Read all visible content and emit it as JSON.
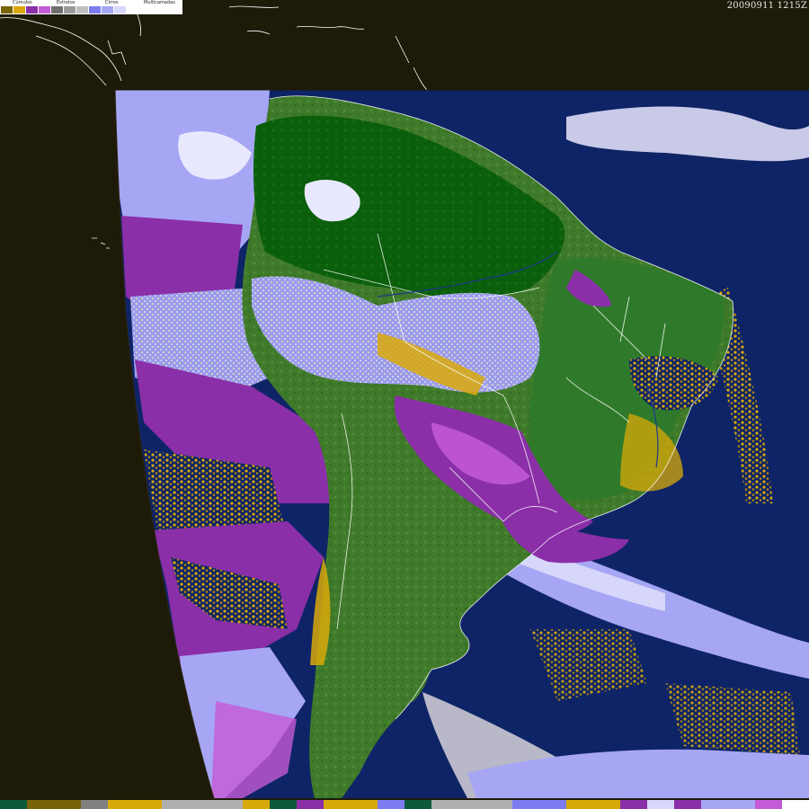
{
  "legend": {
    "categories": [
      {
        "label": "Cúmulos",
        "colors": [
          "#7a6306",
          "#d9a90a"
        ]
      },
      {
        "label": "Estratos",
        "colors": [
          "#8a2fa8",
          "#c55ad6"
        ]
      },
      {
        "label": "Cirros",
        "colors": [
          "#6f6f6f",
          "#9a9a9a",
          "#c0c0c0"
        ]
      },
      {
        "label": "Multicamadas",
        "colors": [
          "#7c7cf0",
          "#a6a6f5",
          "#d7d7fb",
          "#ffffff"
        ]
      }
    ]
  },
  "timestamp": "20090911 1215Z",
  "colors": {
    "space": "#1e1a08",
    "ocean": "#0e2466",
    "land_dark": "#0a5a0a",
    "land_light": "#3f7a2a",
    "cumulus": "#d9a90a",
    "stratus": "#8a2fa8",
    "multilayer": "#a6a6f5",
    "cirrus": "#b8b8c8",
    "coastline": "#ffffff"
  },
  "bottom_bar": [
    "#0d5a3a",
    "#7a6306",
    "#7a6306",
    "#808080",
    "#d9a90a",
    "#d9a90a",
    "#b0b0b0",
    "#b0b0b0",
    "#b0b0b0",
    "#d9a90a",
    "#0d5a3a",
    "#8a2fa8",
    "#d9a90a",
    "#d9a90a",
    "#7c7cf0",
    "#0d5a3a",
    "#b0b0b0",
    "#b0b0b0",
    "#b0b0b0",
    "#7c7cf0",
    "#7c7cf0",
    "#d9a90a",
    "#d9a90a",
    "#8a2fa8",
    "#d7d7fb",
    "#8a2fa8",
    "#a6a6f5",
    "#a6a6f5",
    "#c55ad6",
    "#ffffff"
  ]
}
